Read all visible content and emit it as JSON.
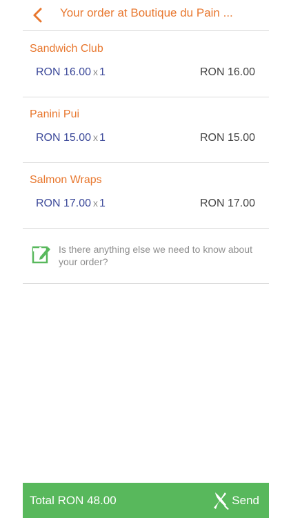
{
  "header": {
    "title": "Your order at Boutique du Pain ...",
    "back_icon": "chevron-left-icon",
    "accent_color": "#e8772e"
  },
  "items": [
    {
      "name": "Sandwich Club",
      "unit_price": "RON 16.00",
      "x": "x",
      "quantity": "1",
      "total": "RON 16.00"
    },
    {
      "name": "Panini Pui",
      "unit_price": "RON 15.00",
      "x": "x",
      "quantity": "1",
      "total": "RON 15.00"
    },
    {
      "name": "Salmon Wraps",
      "unit_price": "RON 17.00",
      "x": "x",
      "quantity": "1",
      "total": "RON 17.00"
    }
  ],
  "note": {
    "placeholder": "Is there anything else we need to know about your order?",
    "icon": "edit-note-icon"
  },
  "footer": {
    "total_label": "Total RON 48.00",
    "send_label": "Send",
    "send_icon": "fork-knife-icon",
    "bar_color": "#58b85c"
  }
}
